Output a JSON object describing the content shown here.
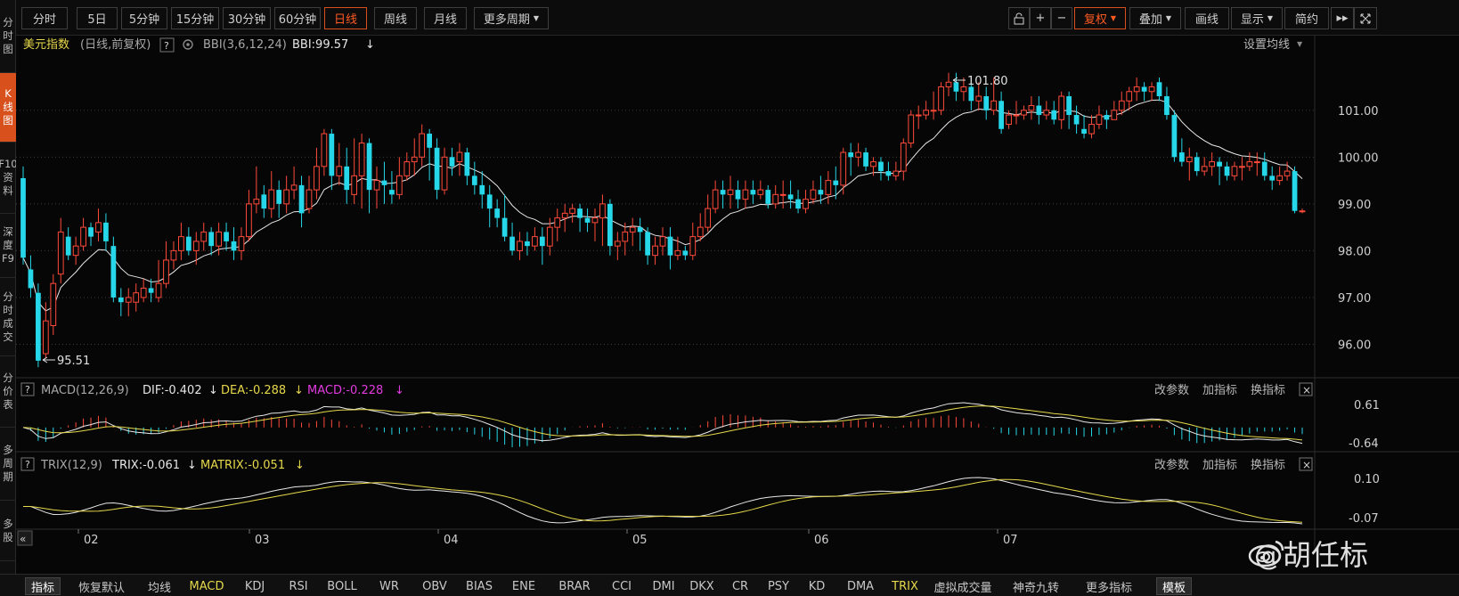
{
  "side_tabs": [
    {
      "label": [
        "分",
        "时",
        "图"
      ],
      "active": false
    },
    {
      "label": [
        "K",
        "线",
        "图"
      ],
      "active": true
    },
    {
      "label": [
        "F10",
        "资",
        "料"
      ],
      "active": false
    },
    {
      "label": [
        "深",
        "度",
        "F9"
      ],
      "active": false
    },
    {
      "label": [
        "分",
        "时",
        "成",
        "交"
      ],
      "active": false
    },
    {
      "label": [
        "分",
        "价",
        "表"
      ],
      "active": false
    },
    {
      "label": [
        "多",
        "周",
        "期"
      ],
      "active": false
    },
    {
      "label": [
        "多",
        "股"
      ],
      "active": false
    }
  ],
  "toolbar": {
    "periods": [
      "分时",
      "5日",
      "5分钟",
      "15分钟",
      "30分钟",
      "60分钟",
      "日线",
      "周线",
      "月线",
      "更多周期"
    ],
    "active_period": "日线",
    "right": {
      "lock": "lock-icon",
      "plus": "+",
      "minus": "−",
      "adjust": "复权",
      "overlay": "叠加",
      "draw": "画线",
      "display": "显示",
      "simple": "简约",
      "forward": "▸▸",
      "expand": "expand-icon"
    }
  },
  "main_chart": {
    "name": "美元指数",
    "mode": "(日线,前复权)",
    "help": "?",
    "indicator": "BBI(3,6,12,24)",
    "indicator_value": "BBI:99.57",
    "arrow": "↓",
    "set_ma": "设置均线",
    "high_label": "101.80",
    "low_label": "95.51",
    "y_ticks": [
      "101.00",
      "100.00",
      "99.00",
      "98.00",
      "97.00",
      "96.00"
    ]
  },
  "macd_panel": {
    "help": "?",
    "name": "MACD(12,26,9)",
    "dif": "DIF:-0.402",
    "dea": "DEA:-0.288",
    "macd": "MACD:-0.228",
    "arrow": "↓",
    "change_params": "改参数",
    "add_indicator": "加指标",
    "switch_indicator": "换指标",
    "close": "×",
    "y_ticks": [
      "0.61",
      "-0.64"
    ]
  },
  "trix_panel": {
    "help": "?",
    "name": "TRIX(12,9)",
    "trix": "TRIX:-0.061",
    "matrix": "MATRIX:-0.051",
    "arrow": "↓",
    "change_params": "改参数",
    "add_indicator": "加指标",
    "switch_indicator": "换指标",
    "close": "×",
    "y_ticks": [
      "0.10",
      "-0.07"
    ]
  },
  "x_axis": {
    "months": [
      "02",
      "03",
      "04",
      "05",
      "06",
      "07"
    ],
    "collapse": "«"
  },
  "bottom_bar": {
    "items": [
      "指标",
      "恢复默认",
      "均线",
      "MACD",
      "KDJ",
      "RSI",
      "BOLL",
      "WR",
      "OBV",
      "BIAS",
      "ENE",
      "BRAR",
      "CCI",
      "DMI",
      "DKX",
      "CR",
      "PSY",
      "KD",
      "DMA",
      "TRIX",
      "虚拟成交量",
      "神奇九转",
      "更多指标",
      "模板"
    ],
    "selected": [
      "指标",
      "模板"
    ],
    "yellow": [
      "MACD",
      "TRIX"
    ]
  },
  "watermark": "@胡任标",
  "colors": {
    "up": "#ff4a3a",
    "down": "#25d7e8",
    "accent": "#d8501c",
    "yellow": "#e6d84b",
    "magenta": "#e23be0"
  },
  "chart_data": {
    "type": "candlestick",
    "y_range": [
      95.4,
      102.1
    ],
    "candles": [
      [
        99.55,
        97.85,
        99.8,
        97.7
      ],
      [
        97.6,
        97.2,
        97.9,
        97.0
      ],
      [
        97.1,
        95.65,
        97.3,
        95.51
      ],
      [
        95.8,
        96.5,
        96.9,
        95.7
      ],
      [
        96.4,
        97.3,
        97.5,
        96.2
      ],
      [
        97.5,
        98.4,
        98.7,
        97.3
      ],
      [
        98.3,
        97.9,
        98.5,
        97.8
      ],
      [
        97.9,
        98.1,
        98.3,
        97.7
      ],
      [
        98.1,
        98.5,
        98.7,
        98.0
      ],
      [
        98.5,
        98.3,
        98.6,
        98.1
      ],
      [
        98.4,
        98.6,
        98.9,
        98.2
      ],
      [
        98.6,
        98.2,
        98.8,
        98.0
      ],
      [
        98.1,
        97.0,
        98.3,
        96.9
      ],
      [
        97.0,
        96.9,
        97.2,
        96.6
      ],
      [
        96.9,
        97.0,
        97.2,
        96.6
      ],
      [
        96.9,
        97.1,
        97.3,
        96.7
      ],
      [
        97.0,
        97.2,
        97.4,
        96.9
      ],
      [
        97.2,
        97.1,
        97.4,
        96.9
      ],
      [
        97.0,
        97.3,
        97.8,
        96.9
      ],
      [
        97.3,
        97.8,
        98.2,
        97.2
      ],
      [
        97.8,
        98.0,
        98.2,
        97.6
      ],
      [
        98.0,
        98.3,
        98.6,
        97.8
      ],
      [
        98.3,
        98.0,
        98.5,
        97.9
      ],
      [
        98.0,
        98.2,
        98.4,
        97.7
      ],
      [
        98.2,
        98.4,
        98.6,
        98.0
      ],
      [
        98.4,
        98.1,
        98.5,
        97.9
      ],
      [
        98.1,
        98.4,
        98.6,
        97.9
      ],
      [
        98.4,
        98.2,
        98.6,
        98.0
      ],
      [
        98.2,
        98.0,
        98.5,
        97.8
      ],
      [
        98.0,
        98.3,
        98.5,
        97.8
      ],
      [
        98.3,
        99.0,
        99.3,
        98.2
      ],
      [
        99.0,
        99.1,
        99.8,
        98.8
      ],
      [
        99.2,
        98.9,
        99.4,
        98.7
      ],
      [
        98.9,
        99.3,
        99.7,
        98.7
      ],
      [
        99.3,
        99.0,
        99.5,
        98.7
      ],
      [
        99.0,
        99.3,
        99.6,
        98.8
      ],
      [
        99.3,
        99.4,
        99.8,
        99.1
      ],
      [
        99.4,
        98.8,
        99.6,
        98.5
      ],
      [
        98.9,
        99.3,
        99.6,
        98.8
      ],
      [
        99.3,
        99.8,
        100.2,
        99.1
      ],
      [
        99.8,
        100.5,
        100.6,
        99.6
      ],
      [
        100.5,
        99.6,
        100.6,
        99.3
      ],
      [
        99.6,
        99.8,
        100.3,
        99.4
      ],
      [
        99.8,
        99.3,
        100.2,
        99.0
      ],
      [
        99.2,
        99.6,
        100.4,
        99.0
      ],
      [
        99.6,
        100.3,
        100.5,
        98.9
      ],
      [
        100.3,
        99.3,
        100.4,
        98.8
      ],
      [
        99.3,
        99.5,
        99.8,
        98.9
      ],
      [
        99.5,
        99.4,
        99.9,
        99.0
      ],
      [
        99.3,
        99.2,
        99.7,
        99.0
      ],
      [
        99.2,
        99.6,
        100.0,
        99.1
      ],
      [
        99.6,
        99.9,
        100.1,
        99.5
      ],
      [
        99.9,
        100.0,
        100.4,
        99.6
      ],
      [
        100.0,
        100.5,
        100.7,
        99.8
      ],
      [
        100.5,
        100.2,
        100.6,
        99.5
      ],
      [
        100.2,
        99.3,
        100.4,
        99.1
      ],
      [
        99.3,
        100.0,
        100.2,
        99.2
      ],
      [
        100.0,
        99.8,
        100.2,
        99.6
      ],
      [
        99.9,
        100.1,
        100.3,
        99.6
      ],
      [
        100.1,
        99.6,
        100.2,
        99.4
      ],
      [
        99.6,
        99.4,
        99.9,
        99.2
      ],
      [
        99.4,
        99.2,
        99.7,
        98.9
      ],
      [
        99.2,
        98.9,
        99.4,
        98.5
      ],
      [
        98.9,
        98.7,
        99.1,
        98.5
      ],
      [
        98.7,
        98.3,
        99.2,
        98.2
      ],
      [
        98.3,
        98.0,
        98.6,
        97.9
      ],
      [
        98.0,
        98.2,
        98.4,
        97.8
      ],
      [
        98.2,
        98.1,
        98.4,
        97.9
      ],
      [
        98.1,
        98.3,
        98.5,
        98.0
      ],
      [
        98.3,
        98.1,
        98.5,
        97.7
      ],
      [
        98.1,
        98.5,
        98.7,
        97.9
      ],
      [
        98.5,
        98.7,
        98.9,
        98.2
      ],
      [
        98.7,
        98.8,
        99.0,
        98.4
      ],
      [
        98.8,
        98.9,
        99.0,
        98.6
      ],
      [
        98.9,
        98.7,
        99.0,
        98.4
      ],
      [
        98.7,
        98.6,
        98.9,
        98.4
      ],
      [
        98.6,
        98.7,
        98.9,
        98.2
      ],
      [
        98.7,
        99.0,
        99.2,
        98.1
      ],
      [
        99.0,
        98.1,
        99.1,
        97.9
      ],
      [
        98.1,
        98.2,
        98.4,
        97.8
      ],
      [
        98.2,
        98.4,
        98.6,
        97.9
      ],
      [
        98.4,
        98.5,
        98.7,
        98.1
      ],
      [
        98.5,
        98.4,
        98.7,
        98.0
      ],
      [
        98.4,
        97.9,
        98.5,
        97.7
      ],
      [
        97.9,
        98.1,
        98.3,
        97.7
      ],
      [
        98.1,
        98.3,
        98.5,
        97.9
      ],
      [
        98.3,
        97.9,
        98.5,
        97.6
      ],
      [
        97.9,
        98.0,
        98.3,
        97.8
      ],
      [
        98.0,
        97.9,
        98.1,
        97.8
      ],
      [
        97.9,
        98.3,
        98.6,
        97.8
      ],
      [
        98.3,
        98.5,
        98.8,
        98.2
      ],
      [
        98.5,
        98.9,
        99.2,
        98.4
      ],
      [
        98.9,
        99.3,
        99.5,
        98.8
      ],
      [
        99.3,
        99.2,
        99.5,
        98.9
      ],
      [
        99.2,
        99.3,
        99.6,
        98.9
      ],
      [
        99.3,
        99.1,
        99.5,
        98.9
      ],
      [
        99.1,
        99.3,
        99.5,
        98.9
      ],
      [
        99.3,
        99.2,
        99.5,
        99.0
      ],
      [
        99.2,
        99.3,
        99.5,
        99.1
      ],
      [
        99.3,
        99.0,
        99.4,
        98.9
      ],
      [
        99.0,
        99.2,
        99.4,
        98.9
      ],
      [
        99.2,
        99.2,
        99.5,
        98.9
      ],
      [
        99.2,
        99.1,
        99.5,
        98.9
      ],
      [
        99.1,
        98.9,
        99.3,
        98.8
      ],
      [
        98.9,
        99.1,
        99.3,
        98.8
      ],
      [
        99.1,
        99.3,
        99.5,
        99.0
      ],
      [
        99.3,
        99.2,
        99.6,
        99.0
      ],
      [
        99.2,
        99.5,
        99.7,
        99.0
      ],
      [
        99.5,
        99.4,
        99.8,
        99.1
      ],
      [
        99.4,
        100.1,
        100.2,
        99.2
      ],
      [
        100.1,
        100.0,
        100.3,
        99.6
      ],
      [
        100.0,
        100.1,
        100.3,
        99.8
      ],
      [
        100.1,
        99.8,
        100.2,
        99.7
      ],
      [
        99.8,
        99.9,
        100.0,
        99.6
      ],
      [
        99.9,
        99.7,
        100.0,
        99.5
      ],
      [
        99.7,
        99.6,
        99.9,
        99.5
      ],
      [
        99.6,
        99.7,
        99.9,
        99.5
      ],
      [
        99.7,
        100.3,
        100.4,
        99.5
      ],
      [
        100.3,
        100.9,
        101.0,
        100.2
      ],
      [
        100.9,
        100.9,
        101.1,
        100.6
      ],
      [
        100.9,
        101.0,
        101.2,
        100.8
      ],
      [
        101.0,
        101.0,
        101.4,
        100.8
      ],
      [
        101.0,
        101.5,
        101.6,
        100.9
      ],
      [
        101.5,
        101.6,
        101.8,
        101.3
      ],
      [
        101.6,
        101.4,
        101.8,
        101.2
      ],
      [
        101.4,
        101.5,
        101.7,
        101.2
      ],
      [
        101.5,
        101.2,
        101.7,
        101.0
      ],
      [
        101.2,
        101.3,
        101.6,
        101.0
      ],
      [
        101.3,
        101.0,
        101.5,
        100.8
      ],
      [
        101.0,
        101.2,
        101.7,
        100.9
      ],
      [
        101.2,
        100.6,
        101.4,
        100.5
      ],
      [
        100.7,
        100.9,
        101.0,
        100.6
      ],
      [
        100.9,
        100.9,
        101.2,
        100.7
      ],
      [
        100.9,
        101.0,
        101.1,
        100.8
      ],
      [
        101.0,
        101.1,
        101.3,
        100.8
      ],
      [
        101.1,
        100.9,
        101.3,
        100.7
      ],
      [
        100.9,
        101.0,
        101.2,
        100.8
      ],
      [
        101.0,
        100.8,
        101.2,
        100.7
      ],
      [
        100.8,
        101.3,
        101.4,
        100.6
      ],
      [
        101.3,
        100.9,
        101.4,
        100.6
      ],
      [
        100.9,
        100.7,
        101.1,
        100.5
      ],
      [
        100.6,
        100.5,
        100.9,
        100.4
      ],
      [
        100.5,
        100.7,
        100.9,
        100.4
      ],
      [
        100.7,
        100.9,
        101.1,
        100.6
      ],
      [
        100.9,
        100.8,
        101.0,
        100.6
      ],
      [
        100.8,
        101.0,
        101.2,
        100.8
      ],
      [
        101.0,
        101.2,
        101.4,
        100.9
      ],
      [
        101.2,
        101.4,
        101.5,
        101.0
      ],
      [
        101.4,
        101.5,
        101.7,
        101.2
      ],
      [
        101.5,
        101.4,
        101.6,
        101.2
      ],
      [
        101.4,
        101.5,
        101.6,
        101.2
      ],
      [
        101.6,
        101.3,
        101.7,
        101.2
      ],
      [
        101.3,
        100.9,
        101.5,
        100.8
      ],
      [
        100.9,
        100.0,
        101.0,
        99.9
      ],
      [
        100.1,
        99.9,
        100.4,
        99.8
      ],
      [
        99.9,
        100.0,
        100.2,
        99.5
      ],
      [
        100.0,
        99.7,
        100.1,
        99.6
      ],
      [
        99.7,
        99.8,
        100.0,
        99.6
      ],
      [
        99.8,
        99.9,
        100.1,
        99.6
      ],
      [
        99.9,
        99.8,
        100.0,
        99.4
      ],
      [
        99.8,
        99.6,
        99.9,
        99.5
      ],
      [
        99.6,
        99.8,
        99.9,
        99.5
      ],
      [
        99.8,
        99.8,
        100.0,
        99.5
      ],
      [
        99.8,
        99.9,
        100.1,
        99.7
      ],
      [
        99.9,
        99.9,
        100.1,
        99.6
      ],
      [
        99.9,
        99.6,
        100.1,
        99.5
      ],
      [
        99.6,
        99.5,
        99.8,
        99.3
      ],
      [
        99.5,
        99.6,
        99.8,
        99.4
      ],
      [
        99.6,
        99.7,
        99.9,
        99.5
      ],
      [
        99.7,
        98.85,
        99.8,
        98.8
      ],
      [
        98.85,
        98.85,
        98.9,
        98.8
      ]
    ]
  }
}
